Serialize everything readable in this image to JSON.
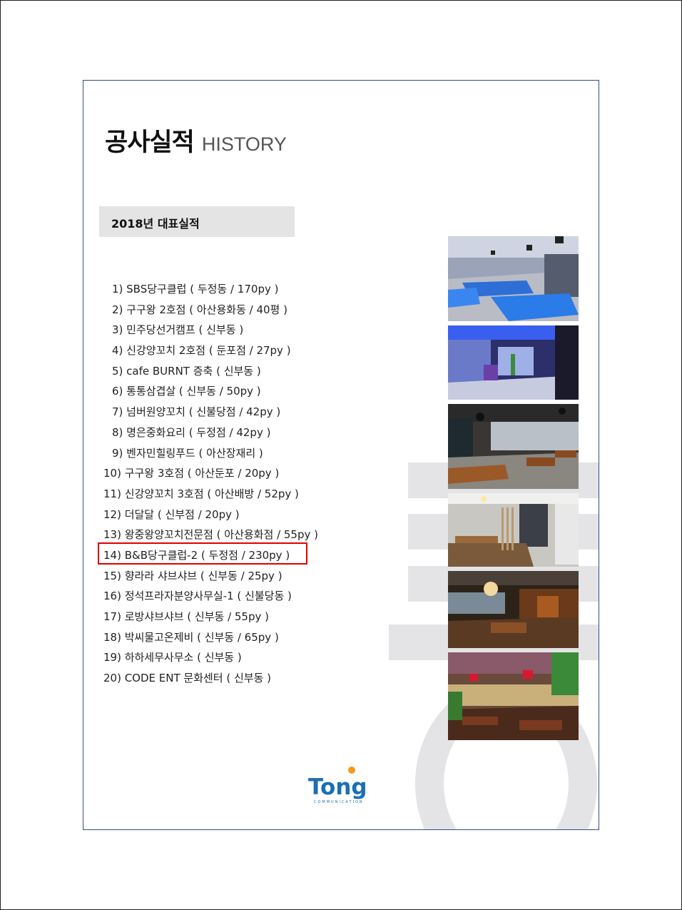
{
  "header": {
    "title_ko": "공사실적",
    "title_en": "HISTORY"
  },
  "section": {
    "label": "2018년 대표실적"
  },
  "projects": [
    "1) SBS당구클럽 ( 두정동 / 170py )",
    "2) 구구왕 2호점 ( 아산용화동 / 40평 )",
    "3) 민주당선거캠프 ( 신부동 )",
    "4) 신강양꼬치 2호점 ( 둔포점 / 27py )",
    "5) cafe BURNT 증축 ( 신부동 )",
    "6) 통통삼겹살 ( 신부동 / 50py )",
    "7) 넘버원양꼬치 ( 신불당점 / 42py )",
    "8) 명은중화요리 ( 두정점 / 42py )",
    "9) 벤자민힐링푸드 ( 아산장재리 )",
    "10) 구구왕 3호점 ( 아산둔포 / 20py )",
    "11) 신강양꼬치 3호점 ( 아산배방 / 52py )",
    "12) 더달달 ( 신부점 / 20py )",
    "13) 왕중왕양꼬치전문점 ( 아산용화점 / 55py )",
    "14) B&B당구클럽-2 ( 두정점 / 230py )",
    "15) 향라라 샤브샤브 ( 신부동 / 25py )",
    "16) 정석프라자분양사무실-1 ( 신불당동 )",
    "17) 로방샤브샤브 ( 신부동 / 55py )",
    "18) 박씨물고온제비 ( 신부동 / 65py )",
    "19) 하하세무사무소 ( 신부동 )",
    "20) CODE ENT 문화센터 ( 신부동 )"
  ],
  "highlighted_index": 13,
  "logo": {
    "text": "Tong",
    "subtext": "COMMUNICATION"
  },
  "colors": {
    "border": "#3a4a86",
    "highlight": "#e00000",
    "logo_blue": "#1a6fb5",
    "logo_orange": "#f39a1e",
    "deco_gray": "#e4e4e6"
  }
}
